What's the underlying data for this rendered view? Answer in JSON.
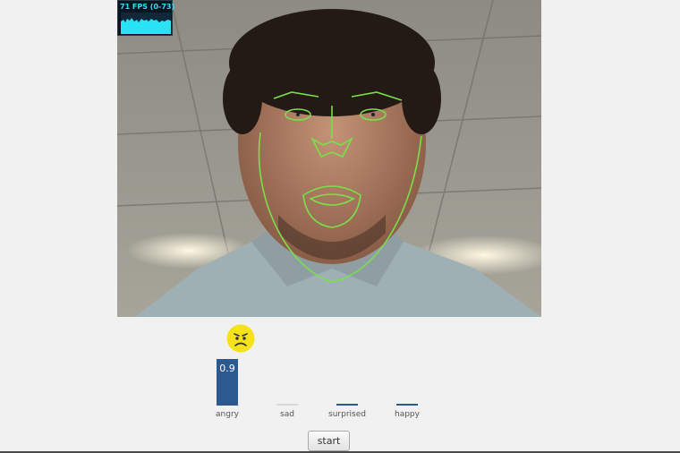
{
  "fps": {
    "label": "71 FPS (0-73)"
  },
  "emotion": {
    "current": "angry",
    "icon": "angry-face-icon"
  },
  "chart_data": {
    "type": "bar",
    "categories": [
      "angry",
      "sad",
      "surprised",
      "happy"
    ],
    "values": [
      0.9,
      0.0,
      0.02,
      0.02
    ],
    "value_labels": [
      "0.9",
      "",
      "",
      ""
    ],
    "ylim": [
      0,
      1
    ],
    "bar_color": "#2c5a8f"
  },
  "controls": {
    "start_label": "start"
  },
  "colors": {
    "overlay": "#7ae04a",
    "fps_text": "#27e3f3",
    "bar": "#2c5a8f",
    "emoji": "#f5e21b"
  }
}
